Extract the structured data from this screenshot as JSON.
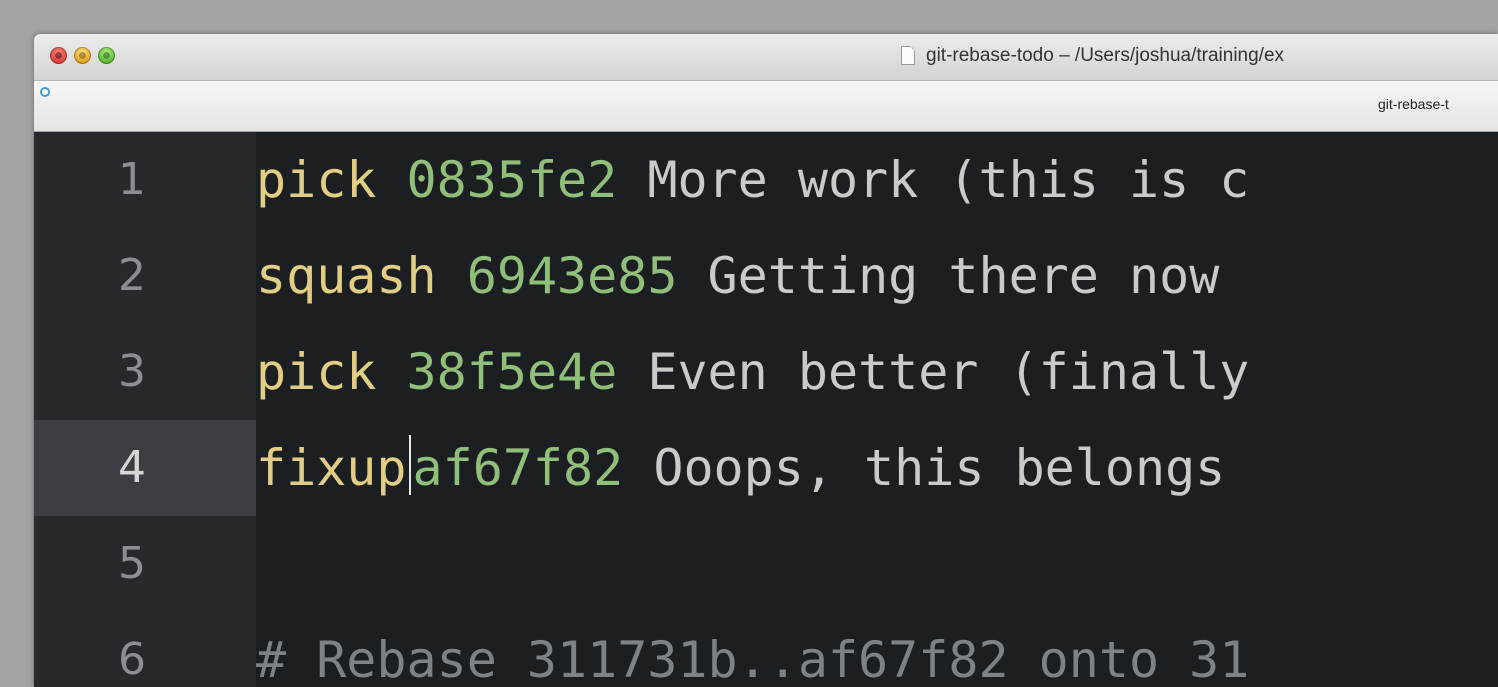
{
  "window": {
    "title": "git-rebase-todo – /Users/joshua/training/ex"
  },
  "tab": {
    "label": "git-rebase-t"
  },
  "colors": {
    "keyword": "#e3cd85",
    "hash": "#8fbf78",
    "text": "#c9cbca",
    "comment": "#7d8286",
    "background": "#1c1f21",
    "gutter": "#27292c",
    "active_line": "#3b3e42"
  },
  "editor": {
    "lines": [
      {
        "number": "1",
        "command": "pick",
        "hash": "0835fe2",
        "message": " More work (this is c"
      },
      {
        "number": "2",
        "command": "squash",
        "hash": "6943e85",
        "message": " Getting there now"
      },
      {
        "number": "3",
        "command": "pick",
        "hash": "38f5e4e",
        "message": " Even better (finally"
      },
      {
        "number": "4",
        "command": "fixup",
        "hash": "af67f82",
        "message": " Ooops, this belongs"
      },
      {
        "number": "5",
        "command": "",
        "hash": "",
        "message": ""
      },
      {
        "number": "6",
        "comment": "# Rebase 311731b..af67f82 onto 31"
      }
    ],
    "active_line": "4"
  }
}
